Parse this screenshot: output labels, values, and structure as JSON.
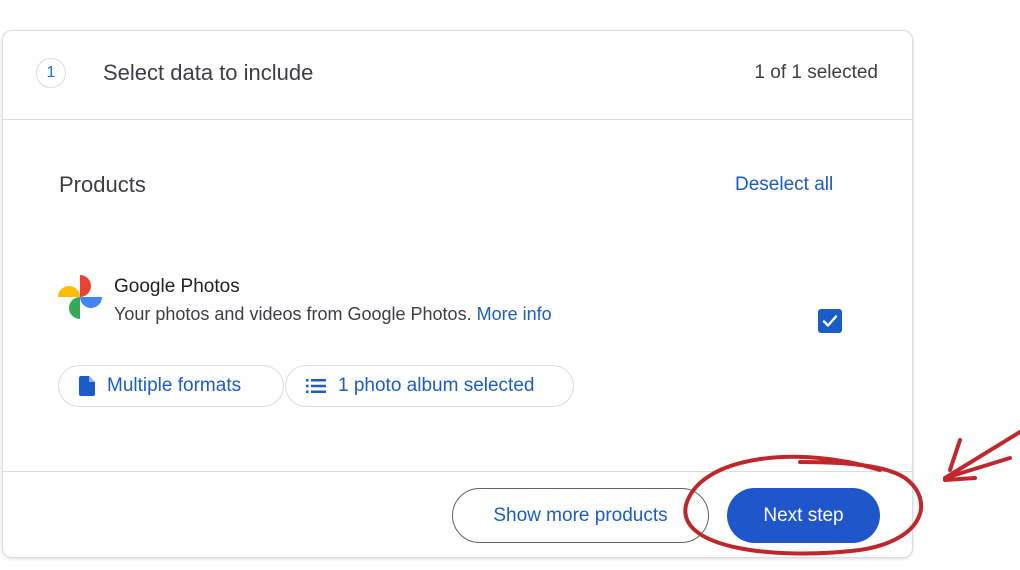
{
  "step": {
    "number": "1",
    "title": "Select data to include",
    "selection_count": "1 of 1 selected"
  },
  "products": {
    "title": "Products",
    "deselect_label": "Deselect all",
    "items": [
      {
        "name": "Google Photos",
        "description": "Your photos and videos from Google Photos.",
        "more_info_label": "More info",
        "checked": true,
        "chips": [
          {
            "label": "Multiple formats",
            "icon": "file-icon"
          },
          {
            "label": "1 photo album selected",
            "icon": "list-icon"
          }
        ]
      }
    ]
  },
  "footer": {
    "show_more_label": "Show more products",
    "next_label": "Next step"
  },
  "colors": {
    "accent": "#1a5cc8",
    "primary_button": "#1f56c9",
    "annotation_red": "#c0272d",
    "border": "#dadce0"
  }
}
